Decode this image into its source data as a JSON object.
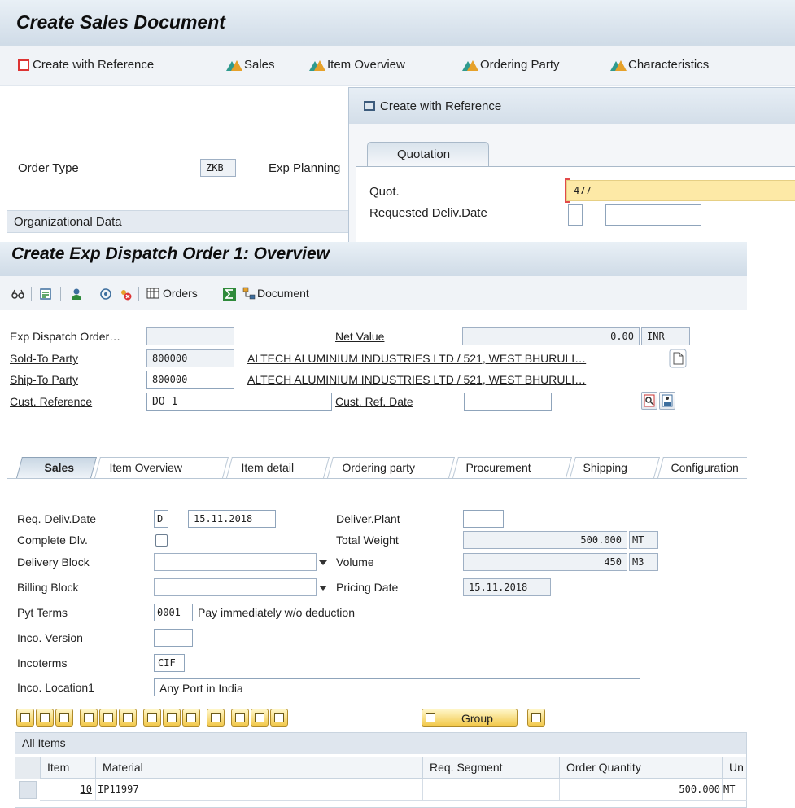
{
  "background": {
    "title": "Create Sales Document",
    "toolbar": {
      "create_ref": "Create with Reference",
      "sales": "Sales",
      "item_overview": "Item Overview",
      "ordering_party": "Ordering Party",
      "characteristics": "Characteristics"
    },
    "order_type_label": "Order Type",
    "order_type_value": "ZKB",
    "exp_planning_label": "Exp Planning",
    "org_data_label": "Organizational Data"
  },
  "popup": {
    "title": "Create with Reference",
    "tab": "Quotation",
    "quot_label": "Quot.",
    "quot_value": "477",
    "req_deliv_label": "Requested Deliv.Date"
  },
  "main": {
    "title": "Create Exp Dispatch Order 1: Overview",
    "toolbar": {
      "orders": "Orders",
      "document": "Document"
    },
    "header": {
      "exp_dispatch_label": "Exp Dispatch Order…",
      "net_value_label": "Net Value",
      "net_value": "0.00",
      "currency": "INR",
      "sold_to_label": "Sold-To Party",
      "sold_to_value": "800000",
      "sold_to_desc": "ALTECH ALUMINIUM INDUSTRIES LTD / 521, WEST BHURULI…",
      "ship_to_label": "Ship-To Party",
      "ship_to_value": "800000",
      "ship_to_desc": "ALTECH ALUMINIUM INDUSTRIES LTD / 521, WEST BHURULI…",
      "cust_ref_label": "Cust. Reference",
      "cust_ref_value": "DO 1",
      "cust_ref_date_label": "Cust. Ref. Date"
    },
    "tabs": [
      "Sales",
      "Item Overview",
      "Item detail",
      "Ordering party",
      "Procurement",
      "Shipping",
      "Configuration"
    ],
    "sales_tab": {
      "req_deliv_label": "Req. Deliv.Date",
      "req_deliv_type": "D",
      "req_deliv_date": "15.11.2018",
      "deliver_plant_label": "Deliver.Plant",
      "complete_dlv_label": "Complete Dlv.",
      "total_weight_label": "Total Weight",
      "total_weight": "500.000",
      "weight_unit": "MT",
      "delivery_block_label": "Delivery Block",
      "volume_label": "Volume",
      "volume": "450",
      "volume_unit": "M3",
      "billing_block_label": "Billing Block",
      "pricing_date_label": "Pricing Date",
      "pricing_date": "15.11.2018",
      "pyt_terms_label": "Pyt Terms",
      "pyt_terms_code": "0001",
      "pyt_terms_desc": "Pay immediately w/o deduction",
      "inco_version_label": "Inco. Version",
      "incoterms_label": "Incoterms",
      "incoterms_value": "CIF",
      "inco_location_label": "Inco. Location1",
      "inco_location_value": "Any Port in India"
    },
    "grid_toolbar": {
      "group": "Group"
    },
    "grid": {
      "title": "All Items",
      "columns": [
        "Item",
        "Material",
        "Req. Segment",
        "Order Quantity",
        "Un"
      ],
      "rows": [
        {
          "item": "10",
          "material": "IP11997",
          "segment": "",
          "qty": "500.000",
          "unit": "MT"
        }
      ]
    }
  }
}
